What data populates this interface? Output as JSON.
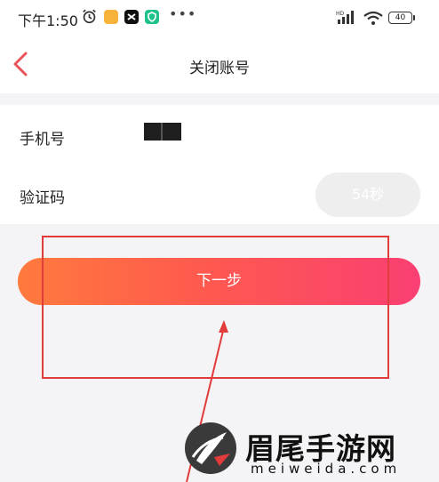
{
  "status_bar": {
    "time": "下午1:50",
    "battery": "40",
    "icons": [
      "alarm-icon",
      "notes-icon",
      "capcut-icon",
      "shield-icon",
      "more-icon",
      "hd-signal-icon",
      "wifi-icon",
      "battery-icon"
    ]
  },
  "nav": {
    "title": "关闭账号",
    "back_icon": "chevron-left-icon"
  },
  "form": {
    "phone_label": "手机号",
    "code_label": "验证码",
    "countdown": "54秒"
  },
  "actions": {
    "next_label": "下一步"
  },
  "watermark": {
    "brand": "眉尾手游网",
    "site": "meiweida.com"
  },
  "colors": {
    "accent_start": "#ff7a3d",
    "accent_end": "#fa3f73",
    "back_icon": "#e8535a",
    "annotation": "#e23b3b"
  }
}
